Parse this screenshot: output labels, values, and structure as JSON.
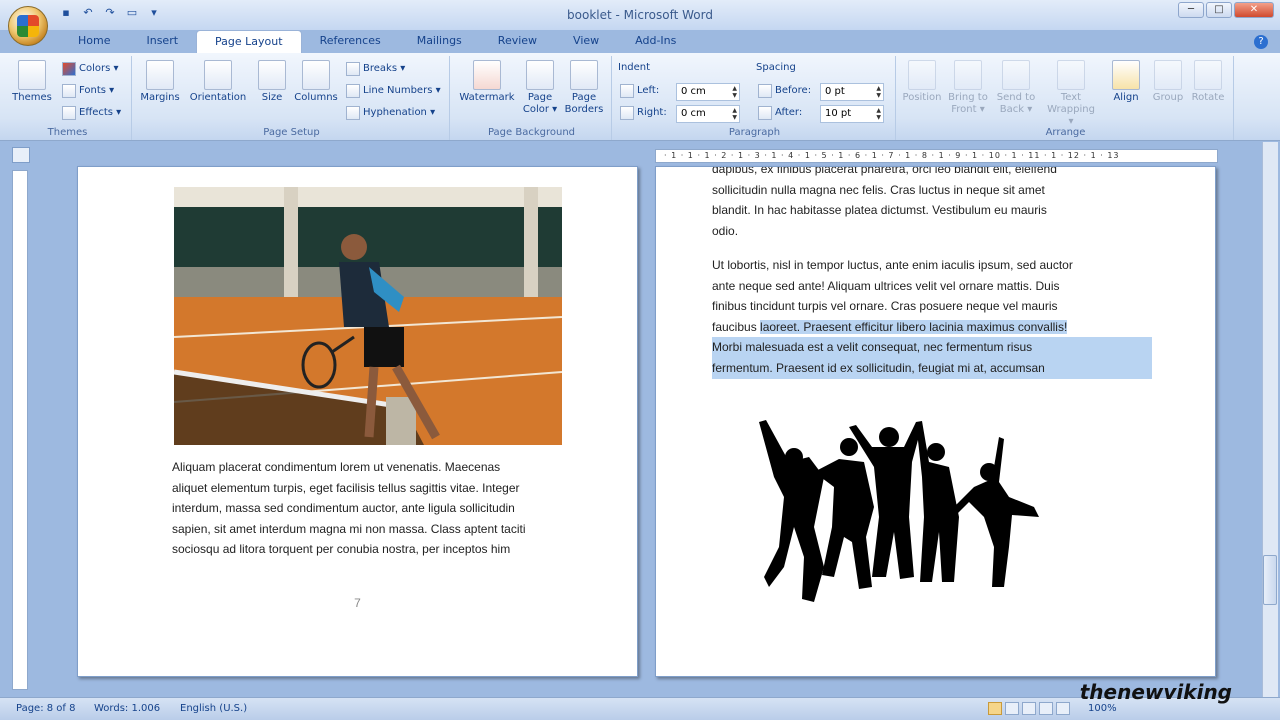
{
  "window": {
    "title": "booklet - Microsoft Word",
    "minimize": "─",
    "maximize": "□",
    "close": "✕"
  },
  "qat": {
    "save": "▪",
    "undo": "↶",
    "redo": "↷",
    "print": "▭",
    "more": "▾"
  },
  "tabs": [
    "Home",
    "Insert",
    "Page Layout",
    "References",
    "Mailings",
    "Review",
    "View",
    "Add-Ins"
  ],
  "active_tab": "Page Layout",
  "help_icon": "?",
  "ribbon": {
    "themes": {
      "label": "Themes",
      "themes_btn": "Themes",
      "colors": "Colors ▾",
      "fonts": "Fonts ▾",
      "effects": "Effects ▾"
    },
    "page_setup": {
      "label": "Page Setup",
      "margins": "Margins",
      "orientation": "Orientation",
      "size": "Size",
      "columns": "Columns",
      "breaks": "Breaks ▾",
      "line_numbers": "Line Numbers ▾",
      "hyphenation": "Hyphenation ▾"
    },
    "page_background": {
      "label": "Page Background",
      "watermark": "Watermark",
      "page_color": "Page Color ▾",
      "page_borders": "Page Borders"
    },
    "paragraph": {
      "label": "Paragraph",
      "indent": "Indent",
      "left_label": "Left:",
      "left_value": "0 cm",
      "right_label": "Right:",
      "right_value": "0 cm",
      "spacing": "Spacing",
      "before_label": "Before:",
      "before_value": "0 pt",
      "after_label": "After:",
      "after_value": "10 pt"
    },
    "arrange": {
      "label": "Arrange",
      "position": "Position",
      "bring_to_front": "Bring to Front ▾",
      "send_to_back": "Send to Back ▾",
      "text_wrapping": "Text Wrapping ▾",
      "align": "Align",
      "group": "Group",
      "rotate": "Rotate"
    }
  },
  "ruler": {
    "ticks": "· 1 · 1 · 1 · 2 · 1 · 3 · 1 · 4 · 1 · 5 · 1 · 6 · 1 · 7 · 1 · 8 · 1 · 9 · 1 · 10 · 1 · 11 · 1 · 12 · 1 · 13"
  },
  "left_page": {
    "paragraph_lines": [
      "Aliquam placerat condimentum lorem ut venenatis. Maecenas",
      "aliquet elementum turpis, eget facilisis tellus sagittis vitae. Integer",
      "interdum, massa sed condimentum auctor, ante ligula sollicitudin",
      "sapien, sit amet interdum magna mi non massa. Class aptent taciti",
      "sociosqu ad litora torquent per conubia nostra, per inceptos him"
    ],
    "page_number": "7"
  },
  "right_page": {
    "para1_lines": [
      "dapibus, ex finibus placerat pharetra, orci leo blandit elit, eleifend",
      "sollicitudin nulla magna nec felis. Cras luctus in neque sit amet",
      "blandit. In hac habitasse platea dictumst. Vestibulum eu mauris",
      "odio."
    ],
    "para2_lines": [
      "Ut lobortis, nisl in tempor luctus, ante enim iaculis ipsum, sed auctor",
      "ante neque sed ante! Aliquam ultrices velit vel ornare mattis. Duis",
      "finibus tincidunt turpis vel ornare. Cras posuere neque vel mauris"
    ],
    "para2_line4_plain": "faucibus ",
    "para2_line4_selected": "laoreet. Praesent efficitur libero lacinia maximus convallis!",
    "para2_selected_lines": [
      "Morbi malesuada est a velit consequat, nec fermentum risus",
      "fermentum. Praesent id ex sollicitudin, feugiat mi at, accumsan"
    ]
  },
  "status": {
    "page": "Page: 8 of 8",
    "words": "Words: 1.006",
    "language": "English (U.S.)",
    "zoom": "100%"
  },
  "watermark_text": "thenewviking"
}
